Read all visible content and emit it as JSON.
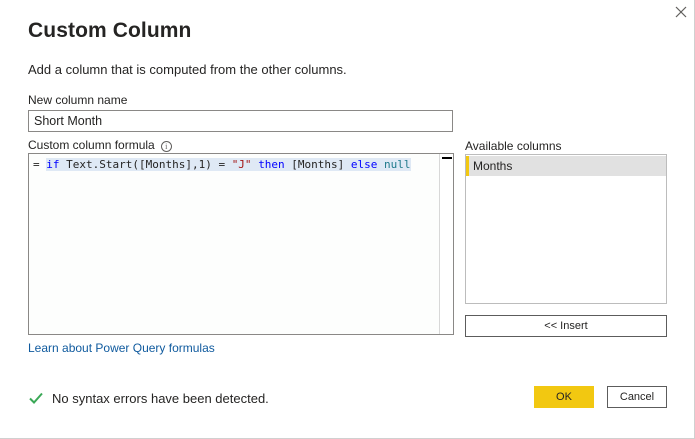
{
  "dialog": {
    "title": "Custom Column",
    "subtitle": "Add a column that is computed from the other columns.",
    "close_icon": "close-icon"
  },
  "new_column": {
    "label": "New column name",
    "value": "Short Month"
  },
  "formula": {
    "label": "Custom column formula",
    "info_icon": "info-icon",
    "info_glyph": "i",
    "prefix": "= ",
    "tokens": {
      "t1": "if",
      "t2": " Text.Start([Months],1) = ",
      "t3": "\"J\"",
      "t4": " ",
      "t5": "then",
      "t6": " [Months] ",
      "t7": "else",
      "t8": " ",
      "t9": "null"
    }
  },
  "available_columns": {
    "label": "Available columns",
    "items": [
      "Months"
    ],
    "accent_color": "#F2C811"
  },
  "insert_button": "<< Insert",
  "learn_link": "Learn about Power Query formulas",
  "status": {
    "icon": "check-icon",
    "text": "No syntax errors have been detected.",
    "color": "#3AA856"
  },
  "buttons": {
    "ok": "OK",
    "cancel": "Cancel",
    "ok_color": "#F2C811"
  }
}
